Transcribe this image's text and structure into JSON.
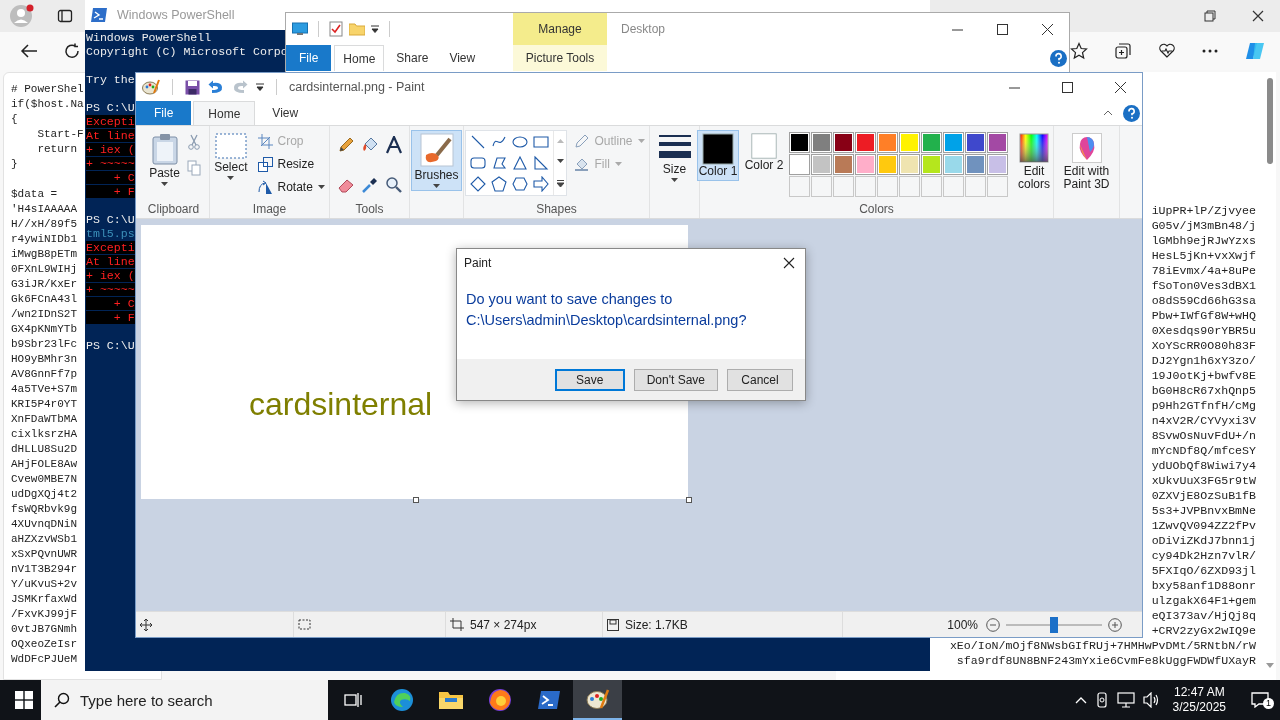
{
  "browser": {
    "code_left": [
      {
        "lines": [
          "# PowerShel",
          "if($host.Na",
          "{",
          "    Start-F",
          "    return",
          "}"
        ]
      },
      {
        "lines": [
          "$data =",
          "'H4sIAAAAA",
          "H//xH/89f5",
          "r4ywiNIDb1",
          "iMwgB8pETm",
          "0FXnL9WIHj",
          "G3iJR/KxEr",
          "Gk6FCnA43l",
          "/wn2IDnS2T",
          "GX4pKNmYTb",
          "b9Sbr23lFc",
          "HO9yBMhr3n",
          "AV8GnnFf7p",
          "4a5TVe+S7m",
          "KRI5P4r0YT",
          "XnFDaWTbMA",
          "cixlksrzHA",
          "dHLLU8Su2D",
          "AHjFOLE8Aw",
          "Cvew0MBE7N",
          "udDgXQj4t2",
          "fsWQRbvk9g",
          "4XUvnqDNiN",
          "aHZXzvWSb1",
          "xSxPQvnUWR",
          "nV1T3B294r",
          "Y/uKvuS+2v",
          "JSMKrfaxWd",
          "/FxvKJ99jF",
          "0vtJB7GNmh",
          "OQxeoZeIsr",
          "WdDFcPJUeM"
        ]
      }
    ],
    "code_right": [
      "iUpPR+lP/Zjvyee",
      "G05v/jM3mBn48/j",
      "lGMbh9ejRJwYzxs",
      "HesL5jKn+vxXwjf",
      "78iEvmx/4a+8uPe",
      "fSoTon0Ves3dBX1",
      "o8dS59Cd66hG3sa",
      "Pbw+IWfGf8W+wHQ",
      "0Xesdqs90rYBR5u",
      "XoYScRR0O80h83F",
      "DJ2Ygn1h6xY3zo/",
      "19J0otKj+bwfv8E",
      "bG0H8cR67xhQnp5",
      "p9Hh2GTfnfH/cMg",
      "n4xV2R/CYVyxi3V",
      "8SvwOsNuvFdU+/n",
      "mYcNDf8Q/mfceSY",
      "ydUObQf8Wiwi7y4",
      "xUkvUuX3FG5r9tW",
      "0ZXVjE8OzSuB1fB",
      "5s3+JVPBnvxBmNe",
      "1ZwvQV094ZZ2fPv",
      "oDiViZKdJ7bnn1j",
      "cy94Dk2Hzn7vlR/",
      "5FXIqO/6ZXD93jl",
      "bxy58anf1D88onr",
      "ulzgakX64F1+gem",
      "eQI373av/HjQj8q",
      "+CRV2zyGx2wIQ9e",
      "xEo/IoN/mOjf8NWsbGIfRUj+7HMHwPvDMt/5RNtbN/rW",
      "sfa9rdf8UN8BNF243mYxie6CvmFe8kUggFWDWfUXayR"
    ]
  },
  "powershell": {
    "title": "Windows PowerShell",
    "blocks": [
      {
        "lines": [
          {
            "text": "Windows PowerShell",
            "kind": "plain"
          },
          {
            "text": "Copyright (C) Microsoft Corpo",
            "kind": "plain"
          }
        ]
      },
      {
        "lines": [
          {
            "text": "Try the",
            "kind": "plain"
          }
        ]
      },
      {
        "lines": [
          {
            "text": "PS C:\\U",
            "kind": "plain"
          },
          {
            "text": "Excepti",
            "kind": "error"
          },
          {
            "text": "At line",
            "kind": "error"
          },
          {
            "text": "+ iex (",
            "kind": "error"
          },
          {
            "text": "+ ~~~~~",
            "kind": "error"
          },
          {
            "text": "    + C",
            "kind": "error"
          },
          {
            "text": "    + F",
            "kind": "error"
          }
        ]
      },
      {
        "lines": [
          {
            "text": "PS C:\\U",
            "kind": "plain"
          },
          {
            "text": "tml5.ps",
            "kind": "path"
          },
          {
            "text": "Excepti",
            "kind": "error"
          },
          {
            "text": "At line",
            "kind": "error"
          },
          {
            "text": "+ iex (",
            "kind": "error"
          },
          {
            "text": "+ ~~~~~",
            "kind": "error"
          },
          {
            "text": "    + C",
            "kind": "error"
          },
          {
            "text": "    + F",
            "kind": "error"
          }
        ]
      },
      {
        "lines": [
          {
            "text": "PS C:\\U",
            "kind": "plain"
          }
        ]
      }
    ]
  },
  "explorer": {
    "context_tab": "Manage",
    "title": "Desktop",
    "context_group": "Picture Tools",
    "tabs": [
      {
        "label": "File",
        "kind": "file",
        "selected": false
      },
      {
        "label": "Home",
        "kind": "tab",
        "selected": true
      },
      {
        "label": "Share",
        "kind": "tab",
        "selected": false
      },
      {
        "label": "View",
        "kind": "tab",
        "selected": false
      }
    ]
  },
  "paint": {
    "title": "cardsinternal.png - Paint",
    "tabs": [
      {
        "label": "File",
        "kind": "file",
        "selected": false
      },
      {
        "label": "Home",
        "kind": "tab",
        "selected": true
      },
      {
        "label": "View",
        "kind": "tab",
        "selected": false
      }
    ],
    "clipboard": {
      "label": "Clipboard",
      "paste": "Paste"
    },
    "image": {
      "label": "Image",
      "select": "Select",
      "commands": [
        {
          "label": "Crop",
          "kind": "crop",
          "disabled": true
        },
        {
          "label": "Resize",
          "kind": "resize",
          "disabled": false
        },
        {
          "label": "Rotate",
          "kind": "rotate",
          "disabled": false
        }
      ]
    },
    "tools": {
      "label": "Tools"
    },
    "brushes": {
      "label": "Brushes",
      "selected": true
    },
    "shapes": {
      "label": "Shapes",
      "commands": [
        {
          "label": "Outline",
          "kind": "outline",
          "disabled": true
        },
        {
          "label": "Fill",
          "kind": "fill",
          "disabled": true
        }
      ]
    },
    "size": {
      "label": "Size"
    },
    "colors": {
      "label": "Colors",
      "slots": [
        {
          "label": "Color 1",
          "color": "#000000",
          "selected": true
        },
        {
          "label": "Color 2",
          "color": "#ffffff",
          "selected": false
        }
      ],
      "palette": [
        {
          "color": "#000000"
        },
        {
          "color": "#7f7f7f"
        },
        {
          "color": "#880015"
        },
        {
          "color": "#ed1c24"
        },
        {
          "color": "#ff7f27"
        },
        {
          "color": "#fff200"
        },
        {
          "color": "#22b14c"
        },
        {
          "color": "#00a2e8"
        },
        {
          "color": "#3f48cc"
        },
        {
          "color": "#a349a4"
        },
        {
          "color": "#ffffff"
        },
        {
          "color": "#c3c3c3"
        },
        {
          "color": "#b97a57"
        },
        {
          "color": "#ffaec9"
        },
        {
          "color": "#ffc90e"
        },
        {
          "color": "#efe4b0"
        },
        {
          "color": "#b5e61d"
        },
        {
          "color": "#99d9ea"
        },
        {
          "color": "#7092be"
        },
        {
          "color": "#c8bfe7"
        }
      ],
      "edit_colors": "Edit colors"
    },
    "paint3d": "Edit with Paint 3D",
    "canvas_text": "cardsinternal",
    "status": {
      "dimensions": "547 × 274px",
      "size": "Size: 1.7KB",
      "zoom": "100%",
      "zoom_level": {
        "level": 0.5
      }
    }
  },
  "dialog": {
    "title": "Paint",
    "message": "Do you want to save changes to C:\\Users\\admin\\Desktop\\cardsinternal.png?",
    "buttons": [
      {
        "label": "Save",
        "default": true
      },
      {
        "label": "Don't Save",
        "default": false
      },
      {
        "label": "Cancel",
        "default": false
      }
    ]
  },
  "taskbar": {
    "search": {
      "placeholder": "Type here to search"
    },
    "apps": [
      {
        "kind": "task-view",
        "selected": false
      },
      {
        "kind": "browser",
        "selected": false
      },
      {
        "kind": "folder",
        "selected": false
      },
      {
        "kind": "fox",
        "selected": false
      },
      {
        "kind": "terminal",
        "selected": false
      },
      {
        "kind": "palette",
        "selected": true
      }
    ],
    "time": "12:47 AM",
    "date": "3/25/2025",
    "notifications": "1"
  }
}
